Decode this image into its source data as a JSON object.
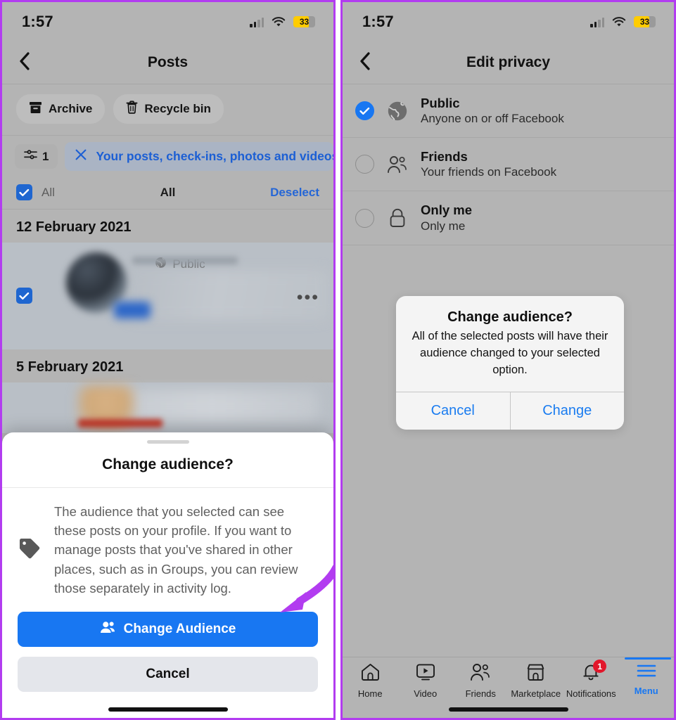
{
  "accent": {
    "facebook_blue": "#1877f2",
    "link_blue": "#1a7cf0",
    "annotation_purple": "#b23cf0",
    "badge_red": "#e2172b",
    "battery_yellow": "#ffcc00"
  },
  "left_panel": {
    "status_bar": {
      "time": "1:57",
      "battery_level": "33",
      "signal_icon": "cellular-signal-icon",
      "wifi_icon": "wifi-icon",
      "battery_icon": "battery-icon"
    },
    "nav": {
      "back_icon": "chevron-left-icon",
      "title": "Posts"
    },
    "chips": [
      {
        "label": "Archive",
        "icon": "archive-box-icon"
      },
      {
        "label": "Recycle bin",
        "icon": "trash-icon"
      }
    ],
    "filter": {
      "count": "1",
      "count_icon": "sliders-icon",
      "clear_icon": "close-x-icon",
      "label": "Your posts, check-ins, photos and videos"
    },
    "select_row": {
      "checkbox_state": "checked",
      "left_label": "All",
      "center_label": "All",
      "right_label": "Deselect"
    },
    "feed": [
      {
        "date": "12 February 2021",
        "checkbox_state": "checked",
        "audience": "Public",
        "audience_icon": "globe-icon",
        "more_icon": "more-options-icon",
        "content": "blurred"
      },
      {
        "date": "5 February 2021",
        "content": "blurred"
      }
    ],
    "sheet": {
      "grabber": "drag-handle",
      "title": "Change audience?",
      "icon": "tag-icon",
      "body": "The audience that you selected can see these posts on your profile. If you want to manage posts that you've shared in other places, such as in Groups, you can review those separately in activity log.",
      "primary_button": {
        "label": "Change Audience",
        "icon": "person-audience-icon"
      },
      "secondary_button": {
        "label": "Cancel"
      }
    },
    "annotation_arrow": "curved-arrow-to-change-audience-button"
  },
  "right_panel": {
    "status_bar": {
      "time": "1:57",
      "battery_level": "33",
      "signal_icon": "cellular-signal-icon",
      "wifi_icon": "wifi-icon",
      "battery_icon": "battery-icon"
    },
    "nav": {
      "back_icon": "chevron-left-icon",
      "title": "Edit privacy"
    },
    "privacy_options": [
      {
        "title": "Public",
        "subtitle": "Anyone on or off Facebook",
        "icon": "globe-icon",
        "selected": true
      },
      {
        "title": "Friends",
        "subtitle": "Your friends on Facebook",
        "icon": "friends-icon",
        "selected": false
      },
      {
        "title": "Only me",
        "subtitle": "Only me",
        "icon": "lock-icon",
        "selected": false
      }
    ],
    "alert": {
      "title": "Change audience?",
      "message": "All of the selected posts will have their audience changed to your selected option.",
      "cancel_label": "Cancel",
      "confirm_label": "Change"
    },
    "annotation_arrow": "curved-arrow-to-change-button",
    "tabbar": [
      {
        "label": "Home",
        "icon": "home-icon",
        "active": false,
        "badge": ""
      },
      {
        "label": "Video",
        "icon": "video-icon",
        "active": false,
        "badge": ""
      },
      {
        "label": "Friends",
        "icon": "friends-icon",
        "active": false,
        "badge": ""
      },
      {
        "label": "Marketplace",
        "icon": "marketplace-icon",
        "active": false,
        "badge": ""
      },
      {
        "label": "Notifications",
        "icon": "bell-icon",
        "active": false,
        "badge": "1"
      },
      {
        "label": "Menu",
        "icon": "hamburger-menu-icon",
        "active": true,
        "badge": ""
      }
    ]
  }
}
